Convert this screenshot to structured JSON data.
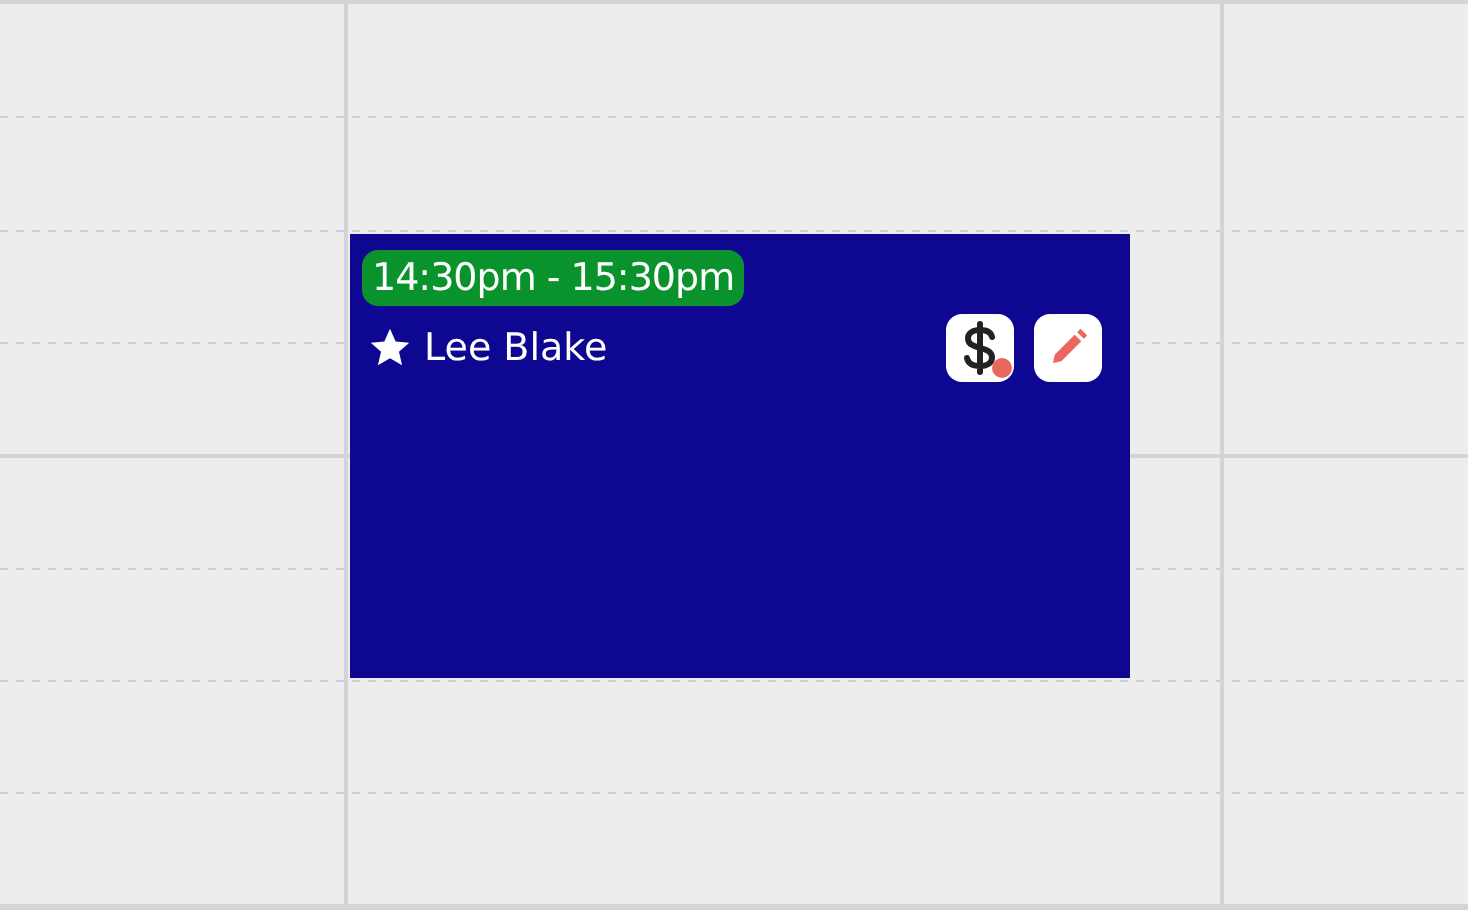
{
  "event": {
    "time": "14:30pm - 15:30pm",
    "name": "Lee Blake",
    "starred": true,
    "payment_alert": true
  }
}
